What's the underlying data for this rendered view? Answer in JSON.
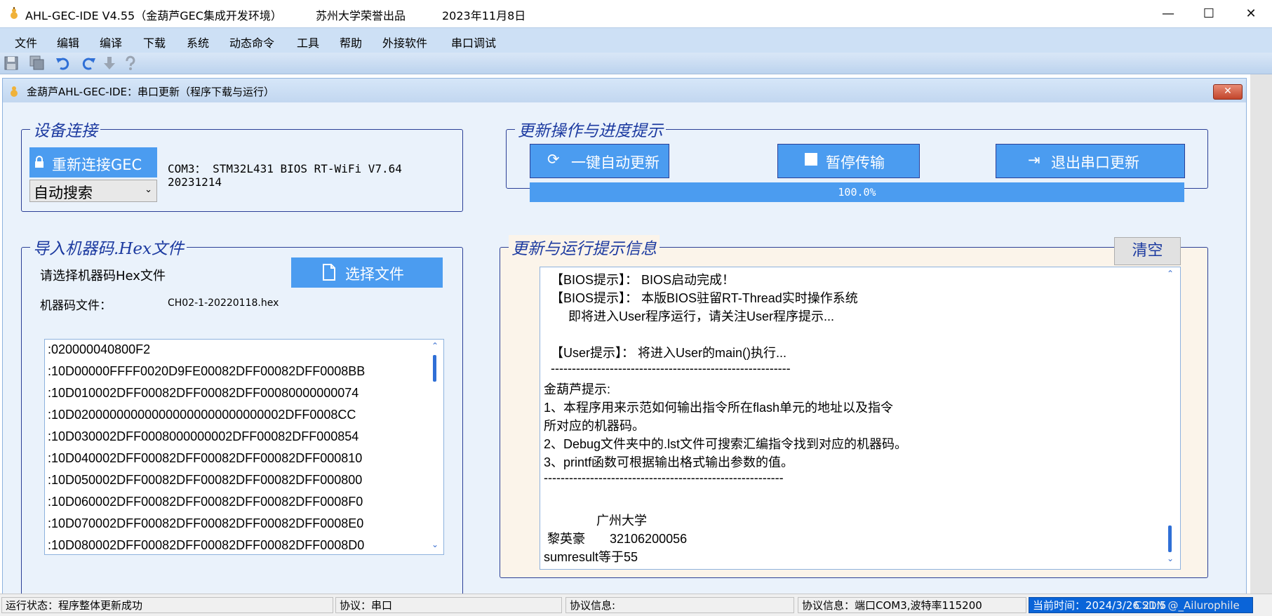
{
  "window": {
    "title": "AHL-GEC-IDE V4.55（金葫芦GEC集成开发环境）",
    "publisher": "苏州大学荣誉出品",
    "date": "2023年11月8日",
    "minimize": "—",
    "maximize": "☐",
    "close": "✕"
  },
  "menu": [
    "文件",
    "编辑",
    "编译",
    "下载",
    "系统",
    "动态命令",
    "工具",
    "帮助",
    "外接软件",
    "串口调试"
  ],
  "toolbar_icons": [
    "save-icon",
    "save-all-icon",
    "undo-icon",
    "redo-icon",
    "download-icon",
    "help-icon"
  ],
  "dialog": {
    "title": "金葫芦AHL-GEC-IDE：串口更新（程序下载与运行）",
    "close": "✕"
  },
  "device": {
    "legend": "设备连接",
    "reconnect_label": "重新连接GEC",
    "search_select": "自动搜索",
    "info_line1": "COM3： STM32L431 BIOS RT-WiFi V7.64",
    "info_line2": "20231214"
  },
  "update": {
    "legend": "更新操作与进度提示",
    "auto_update": "一键自动更新",
    "pause": "暂停传输",
    "exit": "退出串口更新",
    "progress_text": "100.0%",
    "progress_value": 100
  },
  "hex": {
    "legend": "导入机器码.Hex文件",
    "prompt": "请选择机器码Hex文件",
    "select_button": "选择文件",
    "file_label": "机器码文件：",
    "file_name": "CH02-1-20220118.hex",
    "lines": [
      ":020000040800F2",
      ":10D00000FFFF0020D9FE00082DFF00082DFF0008BB",
      ":10D010002DFF00082DFF00082DFF00080000000074",
      ":10D020000000000000000000000000002DFF0008CC",
      ":10D030002DFF0008000000002DFF00082DFF000854",
      ":10D040002DFF00082DFF00082DFF00082DFF000810",
      ":10D050002DFF00082DFF00082DFF00082DFF000800",
      ":10D060002DFF00082DFF00082DFF00082DFF0008F0",
      ":10D070002DFF00082DFF00082DFF00082DFF0008E0",
      ":10D080002DFF00082DFF00082DFF00082DFF0008D0"
    ]
  },
  "runinfo": {
    "legend": "更新与运行提示信息",
    "clear_button": "清空",
    "lines": [
      "  【BIOS提示】： BIOS启动完成！",
      "  【BIOS提示】： 本版BIOS驻留RT-Thread实时操作系统",
      "       即将进入User程序运行，请关注User程序提示...",
      "",
      "  【User提示】： 将进入User的main()执行...",
      "  ---------------------------------------------------------",
      "金葫芦提示:",
      "1、本程序用来示范如何输出指令所在flash单元的地址以及指令",
      "所对应的机器码。",
      "2、Debug文件夹中的.lst文件可搜索汇编指令找到对应的机器码。",
      "3、printf函数可根据输出格式输出参数的值。",
      "---------------------------------------------------------",
      "",
      "",
      "               广州大学",
      " 黎英豪       32106200056",
      "sumresult等于55"
    ]
  },
  "status": {
    "run_state": "运行状态：程序整体更新成功",
    "protocol": "协议：串口",
    "protocol_info": "协议信息:",
    "port_info": "协议信息：端口COM3,波特率115200",
    "time": "当前时间：2024/3/26 21:5",
    "watermark": "CSDN @_Ailurophile"
  },
  "colors": {
    "accent_blue": "#4b9cf0",
    "legend_blue": "#1c3aa0",
    "group_border": "#2b3f96",
    "dialog_bg": "#eaf2fb",
    "log_bg": "#fbf4ea"
  }
}
